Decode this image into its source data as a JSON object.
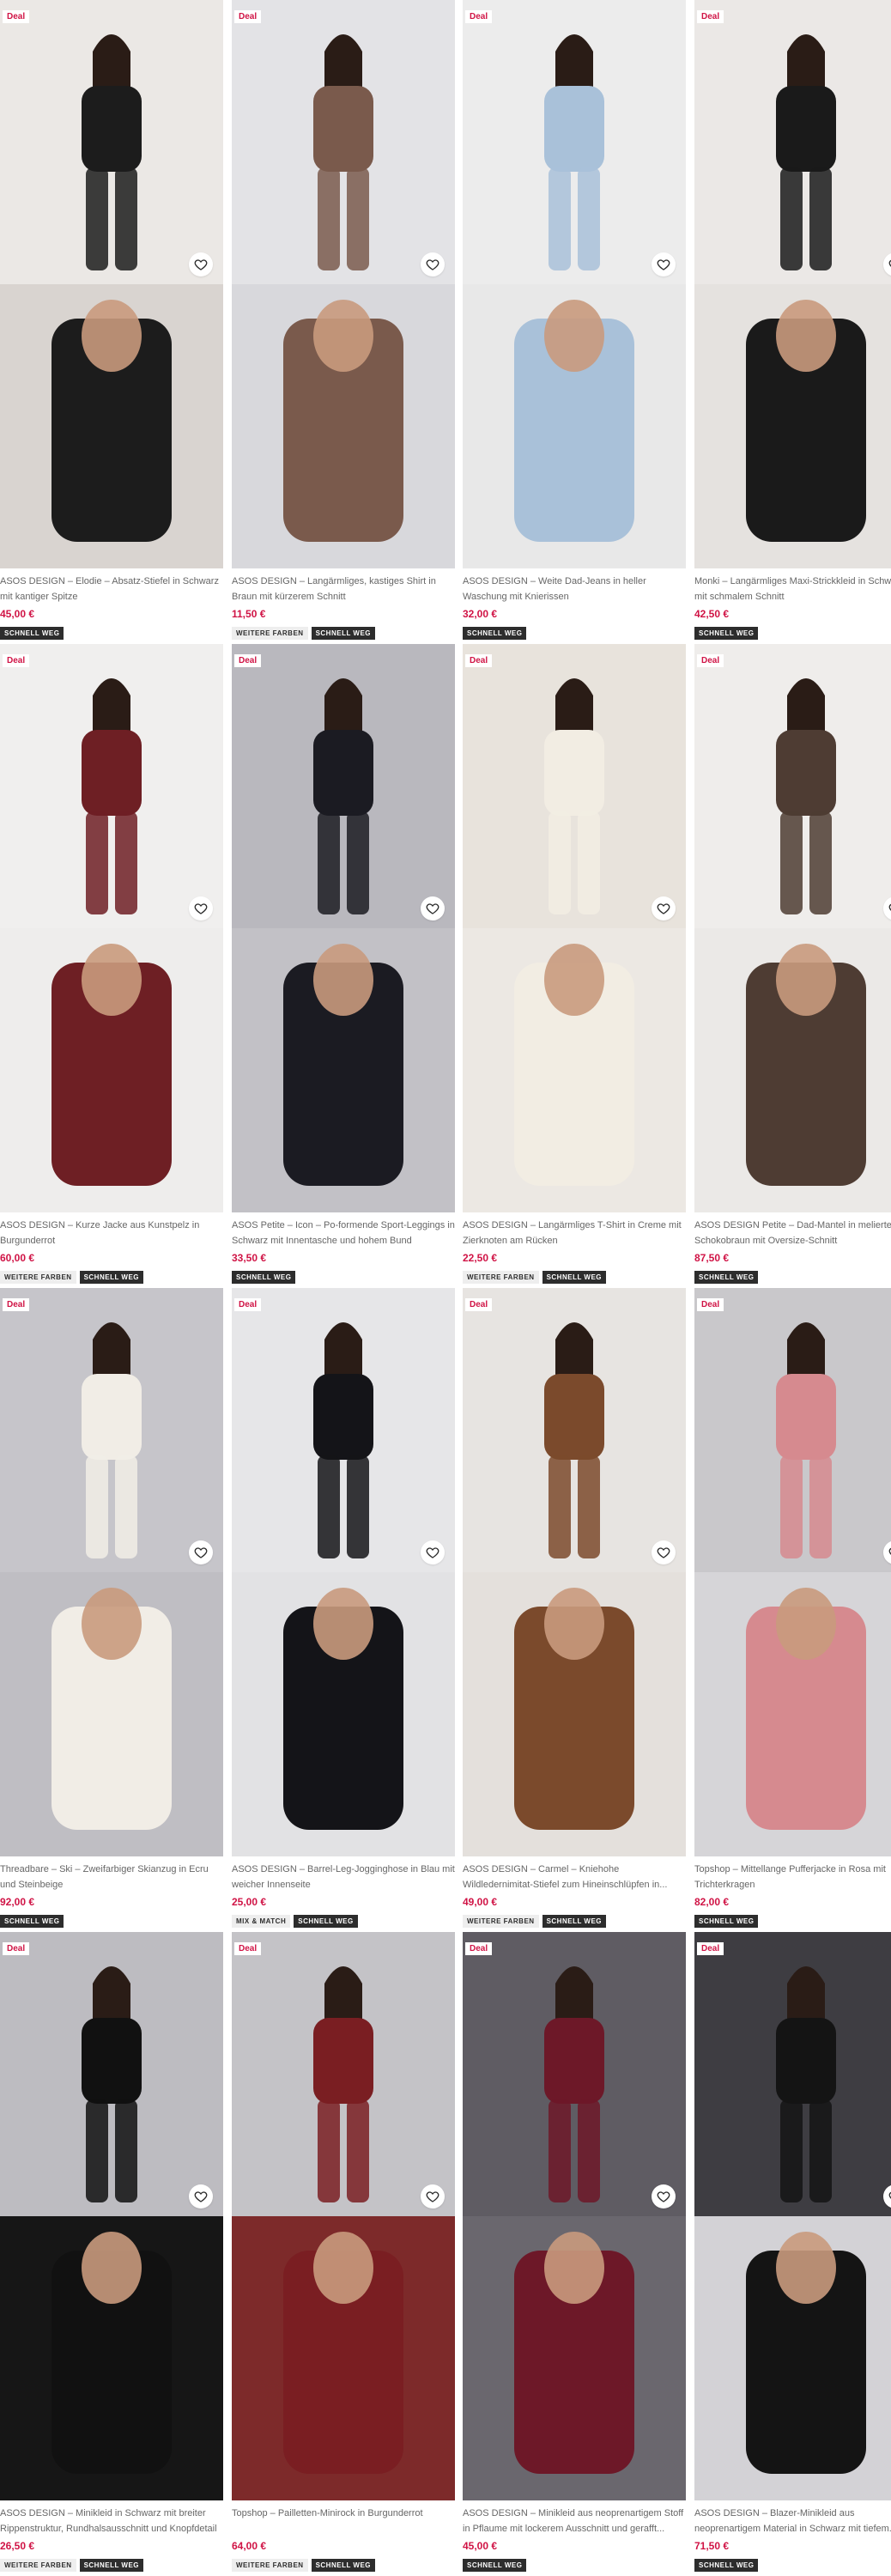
{
  "products": [
    {
      "deal": "Deal",
      "title": "ASOS DESIGN – Elodie – Absatz-Stiefel in Schwarz mit kantiger Spitze",
      "price": "45,00 €",
      "tags": [
        {
          "label": "SCHNELL WEG",
          "style": "dark"
        }
      ],
      "bg_top": "#ebe8e5",
      "bg_bottom": "#d9d4d0",
      "accent": "#1c1c1c"
    },
    {
      "deal": "Deal",
      "title": "ASOS DESIGN – Langärmliges, kastiges Shirt in Braun mit kürzerem Schnitt",
      "price": "11,50 €",
      "tags": [
        {
          "label": "WEITERE FARBEN",
          "style": "light"
        },
        {
          "label": "SCHNELL WEG",
          "style": "dark"
        }
      ],
      "bg_top": "#e3e3e6",
      "bg_bottom": "#d8d8dc",
      "accent": "#7a5a4c"
    },
    {
      "deal": "Deal",
      "title": "ASOS DESIGN – Weite Dad-Jeans in heller Waschung mit Knierissen",
      "price": "32,00 €",
      "tags": [
        {
          "label": "SCHNELL WEG",
          "style": "dark"
        }
      ],
      "bg_top": "#ececec",
      "bg_bottom": "#e8e8e8",
      "accent": "#a9c1d9"
    },
    {
      "deal": "Deal",
      "title": "Monki – Langärmliges Maxi-Strickkleid in Schwarz mit schmalem Schnitt",
      "price": "42,50 €",
      "tags": [
        {
          "label": "SCHNELL WEG",
          "style": "dark"
        }
      ],
      "bg_top": "#ebe8e6",
      "bg_bottom": "#e5e2df",
      "accent": "#1a1a1a"
    },
    {
      "deal": "Deal",
      "title": "ASOS DESIGN – Kurze Jacke aus Kunstpelz in Burgunderrot",
      "price": "60,00 €",
      "tags": [
        {
          "label": "WEITERE FARBEN",
          "style": "light"
        },
        {
          "label": "SCHNELL WEG",
          "style": "dark"
        }
      ],
      "bg_top": "#f0efee",
      "bg_bottom": "#eeedec",
      "accent": "#6e1f24"
    },
    {
      "deal": "Deal",
      "title": "ASOS Petite – Icon – Po-formende Sport-Leggings in Schwarz mit Innentasche und hohem Bund",
      "price": "33,50 €",
      "tags": [
        {
          "label": "SCHNELL WEG",
          "style": "dark"
        }
      ],
      "bg_top": "#b9b8be",
      "bg_bottom": "#c2c1c6",
      "accent": "#1b1b22"
    },
    {
      "deal": "Deal",
      "title": "ASOS DESIGN – Langärmliges T-Shirt in Creme mit Zierknoten am Rücken",
      "price": "22,50 €",
      "tags": [
        {
          "label": "WEITERE FARBEN",
          "style": "light"
        },
        {
          "label": "SCHNELL WEG",
          "style": "dark"
        }
      ],
      "bg_top": "#e8e3dc",
      "bg_bottom": "#ece8e3",
      "accent": "#f2ede3"
    },
    {
      "deal": "Deal",
      "title": "ASOS DESIGN Petite – Dad-Mantel in meliertem Schokobraun mit Oversize-Schnitt",
      "price": "87,50 €",
      "tags": [
        {
          "label": "SCHNELL WEG",
          "style": "dark"
        }
      ],
      "bg_top": "#efedeb",
      "bg_bottom": "#ebe9e7",
      "accent": "#4e3c33"
    },
    {
      "deal": "Deal",
      "title": "Threadbare – Ski – Zweifarbiger Skianzug in Ecru und Steinbeige",
      "price": "92,00 €",
      "tags": [
        {
          "label": "SCHNELL WEG",
          "style": "dark"
        }
      ],
      "bg_top": "#c6c5ca",
      "bg_bottom": "#bfbec3",
      "accent": "#f1ede6"
    },
    {
      "deal": "Deal",
      "title": "ASOS DESIGN – Barrel-Leg-Jogginghose in Blau mit weicher Innenseite",
      "price": "25,00 €",
      "tags": [
        {
          "label": "MIX & MATCH",
          "style": "light"
        },
        {
          "label": "SCHNELL WEG",
          "style": "dark"
        }
      ],
      "bg_top": "#e6e6e8",
      "bg_bottom": "#e2e2e4",
      "accent": "#141418"
    },
    {
      "deal": "Deal",
      "title": "ASOS DESIGN – Carmel – Kniehohe Wildledernimitat-Stiefel zum Hineinschlüpfen in...",
      "price": "49,00 €",
      "tags": [
        {
          "label": "WEITERE FARBEN",
          "style": "light"
        },
        {
          "label": "SCHNELL WEG",
          "style": "dark"
        }
      ],
      "bg_top": "#e7e4e1",
      "bg_bottom": "#e4e0dc",
      "accent": "#7b4a2c"
    },
    {
      "deal": "Deal",
      "title": "Topshop – Mittellange Pufferjacke in Rosa mit Trichterkragen",
      "price": "82,00 €",
      "tags": [
        {
          "label": "SCHNELL WEG",
          "style": "dark"
        }
      ],
      "bg_top": "#c9c8cb",
      "bg_bottom": "#d6d5d8",
      "accent": "#d68a8f"
    },
    {
      "deal": "Deal",
      "title": "ASOS DESIGN – Minikleid in Schwarz mit breiter Rippenstruktur, Rundhalsausschnitt und Knopfdetail",
      "price": "26,50 €",
      "tags": [
        {
          "label": "WEITERE FARBEN",
          "style": "light"
        },
        {
          "label": "SCHNELL WEG",
          "style": "dark"
        }
      ],
      "bg_top": "#bdbcc1",
      "bg_bottom": "#161616",
      "accent": "#111111"
    },
    {
      "deal": "Deal",
      "title": "Topshop – Pailletten-Minirock in Burgunderrot",
      "price": "64,00 €",
      "tags": [
        {
          "label": "WEITERE FARBEN",
          "style": "light"
        },
        {
          "label": "SCHNELL WEG",
          "style": "dark"
        }
      ],
      "bg_top": "#c4c3c7",
      "bg_bottom": "#7d2a2a",
      "accent": "#7a1e22"
    },
    {
      "deal": "Deal",
      "title": "ASOS DESIGN – Minikleid aus neoprenartigem Stoff in Pflaume mit lockerem Ausschnitt und gerafft...",
      "price": "45,00 €",
      "tags": [
        {
          "label": "SCHNELL WEG",
          "style": "dark"
        }
      ],
      "bg_top": "#5f5c63",
      "bg_bottom": "#6a676e",
      "accent": "#6d1828"
    },
    {
      "deal": "Deal",
      "title": "ASOS DESIGN – Blazer-Minikleid aus neoprenartigem Material in Schwarz mit tiefem...",
      "price": "71,50 €",
      "tags": [
        {
          "label": "SCHNELL WEG",
          "style": "dark"
        }
      ],
      "bg_top": "#3e3d42",
      "bg_bottom": "#d3d2d6",
      "accent": "#141414"
    }
  ],
  "icons": {
    "favourite": "heart-outline-icon"
  },
  "colors": {
    "deal_red": "#d01345",
    "price_red": "#d01345",
    "tag_dark": "#2d2d2d",
    "tag_light": "#eeeeee"
  }
}
